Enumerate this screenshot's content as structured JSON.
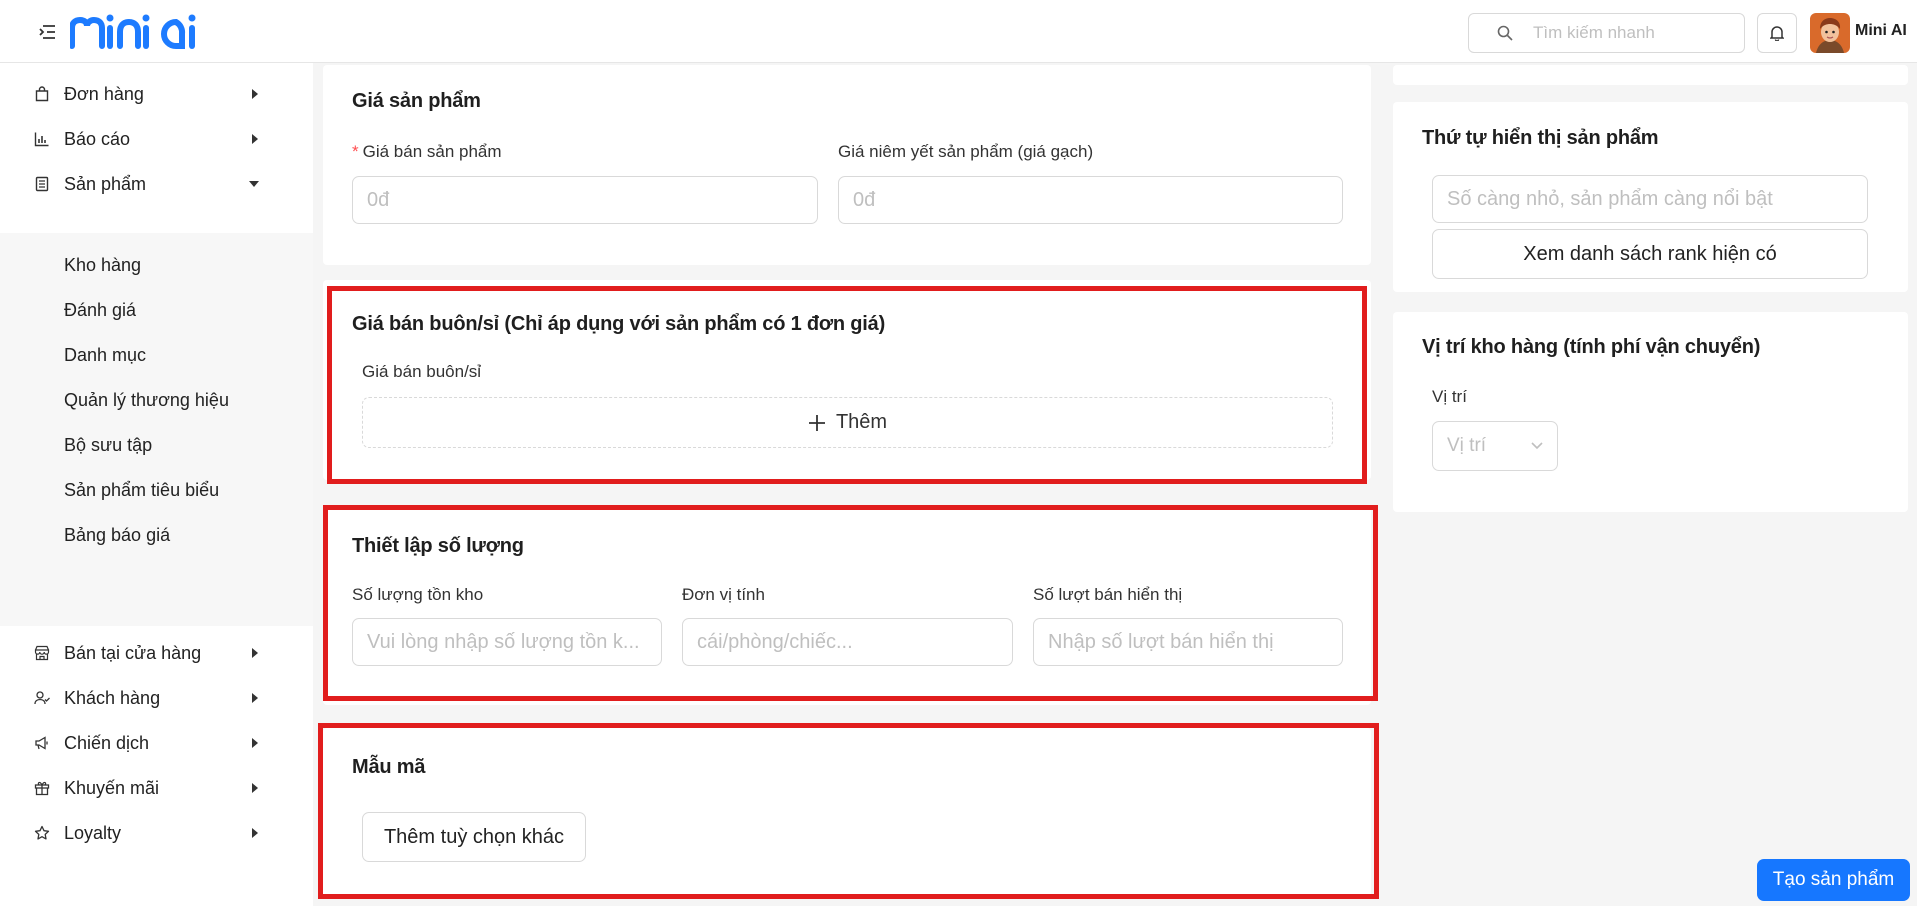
{
  "header": {
    "logo_text": "mini ai",
    "search_placeholder": "Tìm kiếm nhanh",
    "user_name": "Mini AI"
  },
  "sidebar": {
    "items": [
      {
        "label": "Đơn hàng",
        "icon": "bag-icon"
      },
      {
        "label": "Báo cáo",
        "icon": "bar-chart-icon"
      },
      {
        "label": "Sản phẩm",
        "icon": "document-icon"
      },
      {
        "label": "Bán tại cửa hàng",
        "icon": "shop-icon"
      },
      {
        "label": "Khách hàng",
        "icon": "users-icon"
      },
      {
        "label": "Chiến dịch",
        "icon": "megaphone-icon"
      },
      {
        "label": "Khuyến mãi",
        "icon": "gift-icon"
      },
      {
        "label": "Loyalty",
        "icon": "star-icon"
      }
    ],
    "product_submenu": [
      "Kho hàng",
      "Đánh giá",
      "Danh mục",
      "Quản lý thương hiệu",
      "Bộ sưu tập",
      "Sản phẩm tiêu biểu",
      "Bảng báo giá"
    ]
  },
  "price": {
    "title": "Giá sản phẩm",
    "sale_label": "Giá bán sản phẩm",
    "sale_placeholder": "0đ",
    "list_label": "Giá niêm yết sản phẩm (giá gạch)",
    "list_placeholder": "0đ"
  },
  "wholesale": {
    "title": "Giá bán buôn/sỉ (Chỉ áp dụng với sản phẩm có 1 đơn giá)",
    "label": "Giá bán buôn/sỉ",
    "add_label": "Thêm"
  },
  "quantity": {
    "title": "Thiết lập số lượng",
    "stock_label": "Số lượng tồn kho",
    "stock_placeholder": "Vui lòng nhập số lượng tồn k...",
    "unit_label": "Đơn vị tính",
    "unit_placeholder": "cái/phòng/chiếc...",
    "sold_label": "Số lượt bán hiển thị",
    "sold_placeholder": "Nhập số lượt bán hiển thị"
  },
  "variants": {
    "title": "Mẫu mã",
    "add_option_label": "Thêm tuỳ chọn khác"
  },
  "display_order": {
    "title": "Thứ tự hiển thị sản phẩm",
    "placeholder": "Số càng nhỏ, sản phẩm càng nổi bật",
    "rank_button": "Xem danh sách rank hiện có"
  },
  "warehouse": {
    "title": "Vị trí kho hàng (tính phí vận chuyển)",
    "location_label": "Vị trí",
    "location_placeholder": "Vị trí"
  },
  "create_button": "Tạo sản phẩm",
  "colors": {
    "primary": "#1677ff",
    "highlight_frame": "#e11d1d",
    "logo": "#1d7bff"
  }
}
